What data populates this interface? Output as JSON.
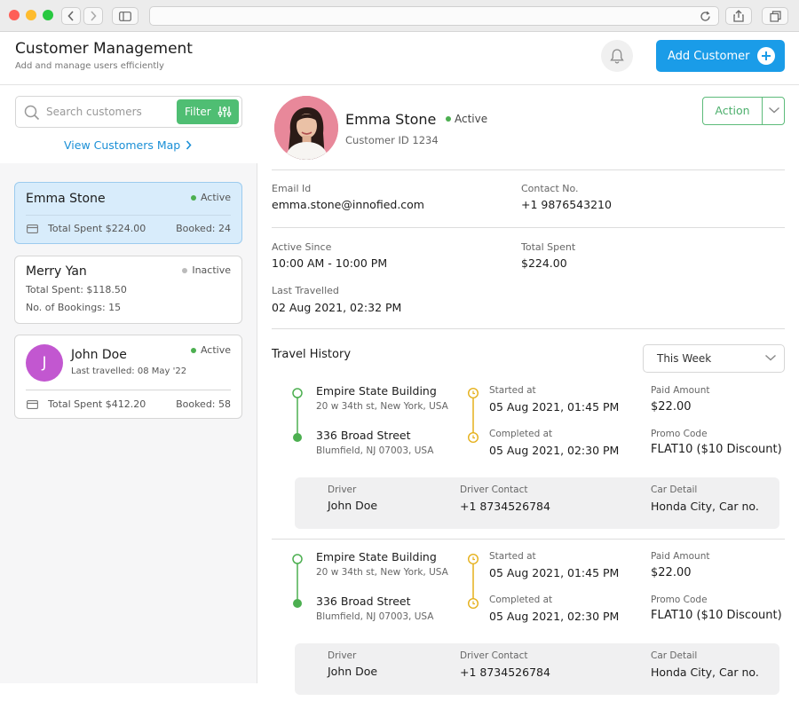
{
  "colors": {
    "accent": "#1a9ce8",
    "green": "#4fbe73",
    "active": "#4caf50",
    "inactive": "#bbbbbb",
    "travel_line": "#4caf50",
    "time_line": "#e5b01a"
  },
  "header": {
    "title": "Customer Management",
    "subtitle": "Add and manage users efficiently",
    "add_button": "Add Customer",
    "bell_icon": "bell-icon"
  },
  "sidebar": {
    "search_placeholder": "Search customers",
    "filter_label": "Filter",
    "map_link": "View Customers Map",
    "customers": [
      {
        "name": "Emma Stone",
        "status": "Active",
        "total": "Total Spent $224.00",
        "booked": "Booked: 24"
      },
      {
        "name": "Merry Yan",
        "status": "Inactive",
        "total": "Total Spent: $118.50",
        "bookings": "No. of Bookings: 15"
      },
      {
        "name": "John Doe",
        "initial": "J",
        "status": "Active",
        "last": "Last travelled: 08 May '22",
        "total": "Total Spent $412.20",
        "booked": "Booked: 58"
      }
    ]
  },
  "profile": {
    "name": "Emma Stone",
    "status": "Active",
    "customer_id": "Customer ID 1234",
    "action_label": "Action",
    "email_label": "Email Id",
    "email": "emma.stone@innofied.com",
    "contact_label": "Contact No.",
    "contact": "+1 9876543210",
    "active_label": "Active Since",
    "active": "10:00 AM - 10:00 PM",
    "spent_label": "Total Spent",
    "spent": "$224.00",
    "last_label": "Last Travelled",
    "last": "02 Aug 2021, 02:32 PM"
  },
  "travel": {
    "title": "Travel History",
    "range": "This Week",
    "trips": [
      {
        "from": "Empire State Building",
        "from_addr": "20 w 34th st, New York, USA",
        "to": "336 Broad Street",
        "to_addr": "Blumfield, NJ 07003, USA",
        "started_label": "Started at",
        "started": "05 Aug 2021, 01:45 PM",
        "completed_label": "Completed at",
        "completed": "05 Aug 2021, 02:30 PM",
        "paid_label": "Paid Amount",
        "paid": "$22.00",
        "promo_label": "Promo Code",
        "promo": "FLAT10 ($10 Discount)",
        "driver_label": "Driver",
        "driver": "John Doe",
        "dcontact_label": "Driver Contact",
        "dcontact": "+1 8734526784",
        "car_label": "Car Detail",
        "car": "Honda City, Car no."
      },
      {
        "from": "Empire State Building",
        "from_addr": "20 w 34th st, New York, USA",
        "to": "336 Broad Street",
        "to_addr": "Blumfield, NJ 07003, USA",
        "started_label": "Started at",
        "started": "05 Aug 2021, 01:45 PM",
        "completed_label": "Completed at",
        "completed": "05 Aug 2021, 02:30 PM",
        "paid_label": "Paid Amount",
        "paid": "$22.00",
        "promo_label": "Promo Code",
        "promo": "FLAT10 ($10 Discount)",
        "driver_label": "Driver",
        "driver": "John Doe",
        "dcontact_label": "Driver Contact",
        "dcontact": "+1 8734526784",
        "car_label": "Car Detail",
        "car": "Honda City, Car no."
      }
    ]
  }
}
